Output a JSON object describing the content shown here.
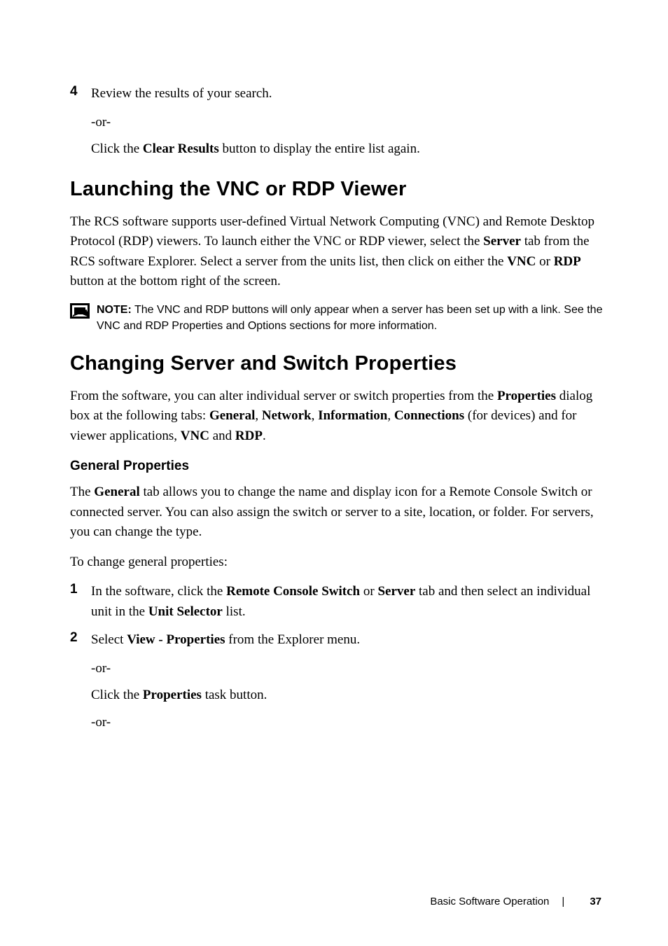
{
  "step4": {
    "num": "4",
    "text_before": "Review the results of your search.",
    "or": "-or-",
    "click_prefix": "Click the ",
    "click_bold": "Clear Results",
    "click_suffix": " button to display the entire list again."
  },
  "section1": {
    "heading": "Launching the VNC or RDP Viewer",
    "para_parts": {
      "p1": "The RCS software supports user-defined Virtual Network Computing (VNC) and Remote Desktop Protocol (RDP) viewers. To launch either the VNC or RDP viewer, select the ",
      "b1": "Server",
      "p2": " tab from the RCS software Explorer. Select a server from the units list, then click on either the ",
      "b2": "VNC",
      "p3": " or ",
      "b3": "RDP",
      "p4": " button at the bottom right of the screen."
    },
    "note_label": "NOTE:",
    "note_text": " The VNC and RDP buttons will only appear when a server has been set up with a link. See the VNC and RDP Properties and Options sections for more information."
  },
  "section2": {
    "heading": "Changing Server and Switch Properties",
    "para_parts": {
      "p1": "From the software, you can alter individual server or switch properties from the ",
      "b1": "Properties",
      "p2": " dialog box at the following tabs: ",
      "b2": "General",
      "p3": ", ",
      "b3": "Network",
      "p4": ", ",
      "b4": "Information",
      "p5": ", ",
      "b5": "Connections",
      "p6": " (for devices) and for viewer applications, ",
      "b6": "VNC",
      "p7": " and ",
      "b7": "RDP",
      "p8": "."
    }
  },
  "subsection": {
    "heading": "General Properties",
    "para_parts": {
      "p1": "The ",
      "b1": "General",
      "p2": " tab allows you to change the name and display icon for a Remote Console Switch or connected server. You can also assign the switch or server to a site, location, or folder. For servers, you can change the type."
    },
    "to_change": "To change general properties:",
    "step1": {
      "num": "1",
      "p1": "In the software, click the ",
      "b1": "Remote Console Switch",
      "p2": " or ",
      "b2": "Server",
      "p3": " tab and then select an individual unit in the ",
      "b3": "Unit Selector",
      "p4": " list."
    },
    "step2": {
      "num": "2",
      "p1": "Select ",
      "b1": "View - Properties",
      "p2": " from the Explorer menu.",
      "or1": "-or-",
      "click_p1": "Click the ",
      "click_b1": "Properties",
      "click_p2": " task button.",
      "or2": "-or-"
    }
  },
  "footer": {
    "title": "Basic Software Operation",
    "divider": "|",
    "page": "37"
  }
}
